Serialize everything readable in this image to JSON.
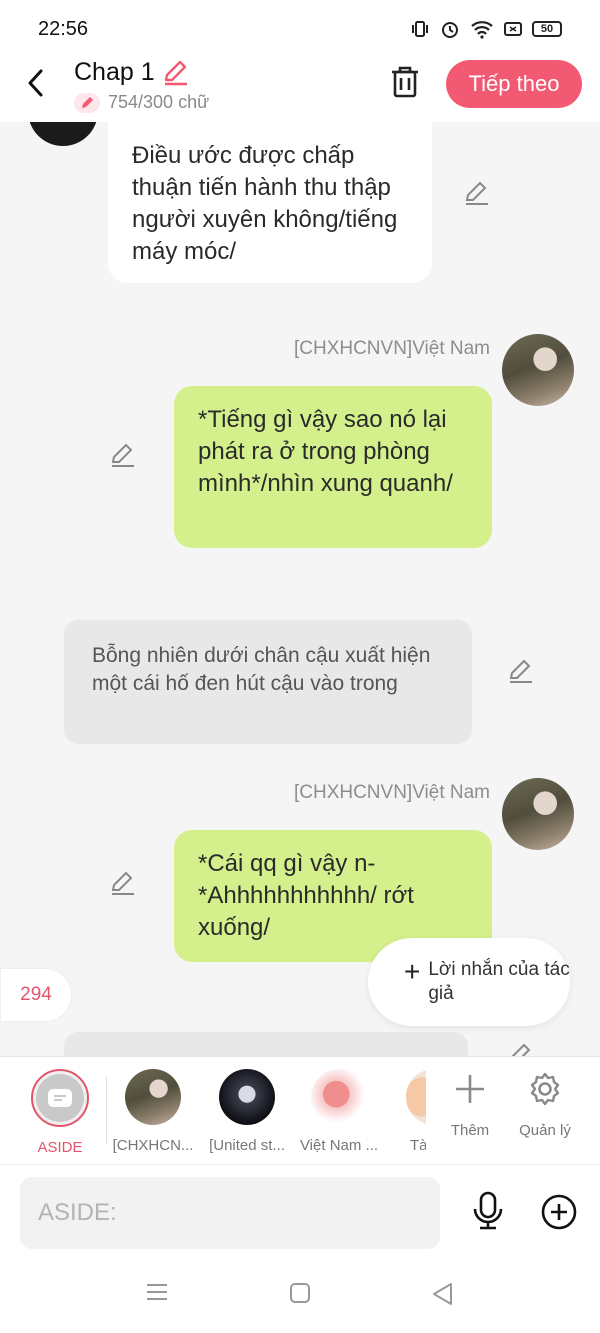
{
  "status_bar": {
    "time": "22:56",
    "battery": "50"
  },
  "header": {
    "title": "Chap 1",
    "word_count": "754/300 chữ",
    "next_label": "Tiếp theo"
  },
  "messages": {
    "m1": {
      "text": "Điều ước được chấp thuận tiến hành thu thập người xuyên không/tiếng máy móc/"
    },
    "m2": {
      "speaker": "[CHXHCNVN]Việt Nam",
      "text": "*Tiếng gì vậy sao nó lại phát ra ở trong phòng mình*/nhìn xung quanh/"
    },
    "m3": {
      "text": "Bỗng nhiên dưới chân cậu xuất hiện một cái hố đen hút cậu vào trong"
    },
    "m4": {
      "speaker": "[CHXHCNVN]Việt Nam",
      "text": "*Cái qq gì vậy n-*Ahhhhhhhhhhh/ rớt xuống/"
    }
  },
  "floating": {
    "count": "294",
    "author_note": "Lời nhắn của tác giả"
  },
  "characters": [
    {
      "label": "ASIDE"
    },
    {
      "label": "[CHXHCN..."
    },
    {
      "label": "[United st..."
    },
    {
      "label": "Việt Nam ..."
    },
    {
      "label": "Tà"
    }
  ],
  "tools": {
    "more": "Thêm",
    "manage": "Quản lý"
  },
  "input": {
    "placeholder": "ASIDE:"
  },
  "colors": {
    "accent": "#f15a72",
    "green_bubble": "#d4f08c",
    "gray_bubble": "#e8e8e8"
  }
}
